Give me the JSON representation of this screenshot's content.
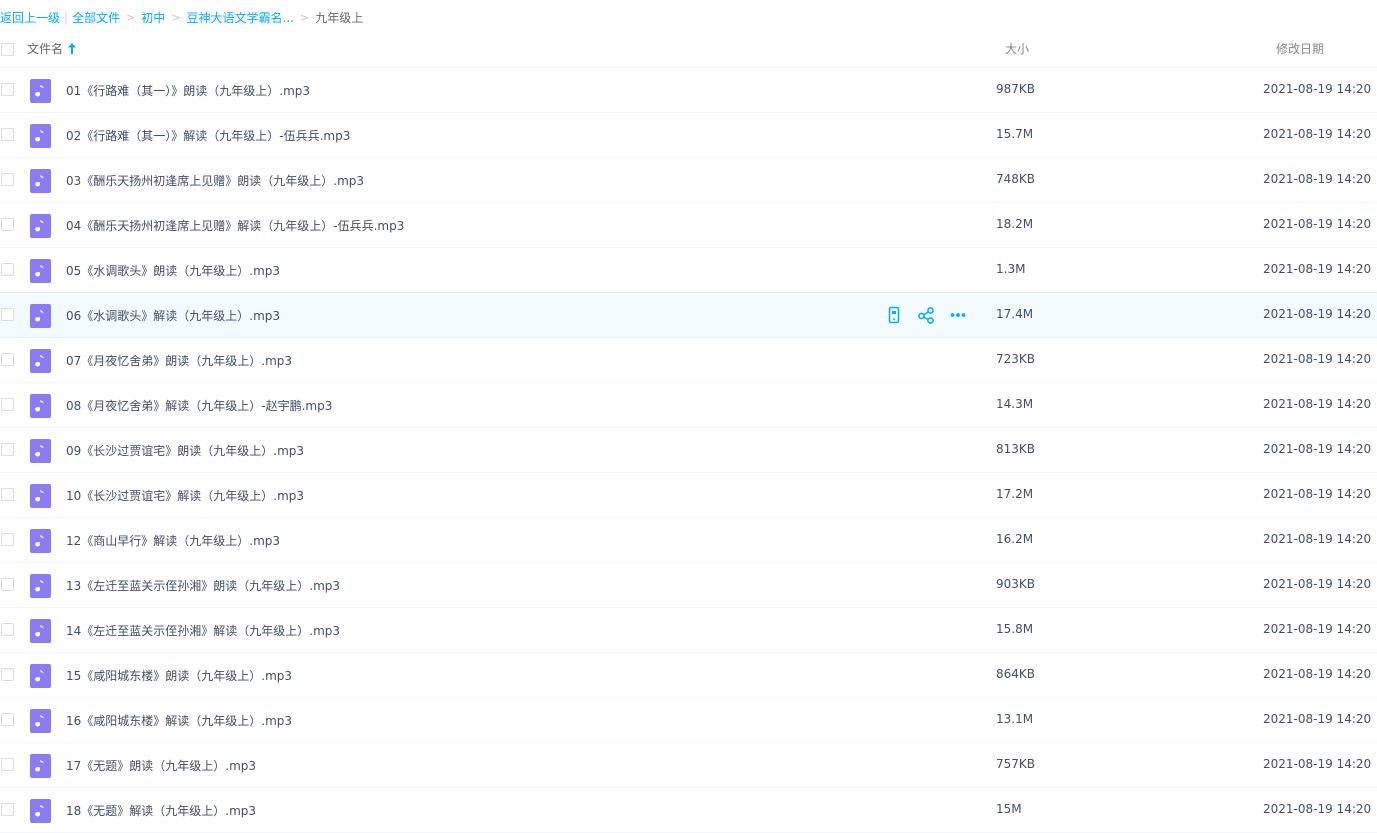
{
  "breadcrumb": {
    "back": "返回上一级",
    "separator": "|",
    "items": [
      {
        "label": "全部文件"
      },
      {
        "label": "初中"
      },
      {
        "label": "豆神大语文学霸名..."
      }
    ],
    "arrow": ">",
    "current": "九年级上"
  },
  "header": {
    "name": "文件名",
    "size": "大小",
    "date": "修改日期",
    "sort_icon": "arrow-up-icon"
  },
  "colors": {
    "accent": "#09aaff",
    "file_icon": "#8c7cf2",
    "hover_row": "#f4fbff"
  },
  "files": [
    {
      "name": "01《行路难（其一）》朗读（九年级上）.mp3",
      "size": "987KB",
      "date": "2021-08-19 14:20"
    },
    {
      "name": "02《行路难（其一）》解读（九年级上）-伍兵兵.mp3",
      "size": "15.7M",
      "date": "2021-08-19 14:20"
    },
    {
      "name": "03《酬乐天扬州初逢席上见赠》朗读（九年级上）.mp3",
      "size": "748KB",
      "date": "2021-08-19 14:20"
    },
    {
      "name": "04《酬乐天扬州初逢席上见赠》解读（九年级上）-伍兵兵.mp3",
      "size": "18.2M",
      "date": "2021-08-19 14:20"
    },
    {
      "name": "05《水调歌头》朗读（九年级上）.mp3",
      "size": "1.3M",
      "date": "2021-08-19 14:20"
    },
    {
      "name": "06《水调歌头》解读（九年级上）.mp3",
      "size": "17.4M",
      "date": "2021-08-19 14:20",
      "hover": true
    },
    {
      "name": "07《月夜忆舍弟》朗读（九年级上）.mp3",
      "size": "723KB",
      "date": "2021-08-19 14:20"
    },
    {
      "name": "08《月夜忆舍弟》解读（九年级上）-赵宇鹏.mp3",
      "size": "14.3M",
      "date": "2021-08-19 14:20"
    },
    {
      "name": "09《长沙过贾谊宅》朗读（九年级上）.mp3",
      "size": "813KB",
      "date": "2021-08-19 14:20"
    },
    {
      "name": "10《长沙过贾谊宅》解读（九年级上）.mp3",
      "size": "17.2M",
      "date": "2021-08-19 14:20"
    },
    {
      "name": "12《商山早行》解读（九年级上）.mp3",
      "size": "16.2M",
      "date": "2021-08-19 14:20"
    },
    {
      "name": "13《左迁至蓝关示侄孙湘》朗读（九年级上）.mp3",
      "size": "903KB",
      "date": "2021-08-19 14:20"
    },
    {
      "name": "14《左迁至蓝关示侄孙湘》解读（九年级上）.mp3",
      "size": "15.8M",
      "date": "2021-08-19 14:20"
    },
    {
      "name": "15《咸阳城东楼》朗读（九年级上）.mp3",
      "size": "864KB",
      "date": "2021-08-19 14:20"
    },
    {
      "name": "16《咸阳城东楼》解读（九年级上）.mp3",
      "size": "13.1M",
      "date": "2021-08-19 14:20"
    },
    {
      "name": "17《无题》朗读（九年级上）.mp3",
      "size": "757KB",
      "date": "2021-08-19 14:20"
    },
    {
      "name": "18《无题》解读（九年级上）.mp3",
      "size": "15M",
      "date": "2021-08-19 14:20"
    }
  ],
  "row_actions": [
    {
      "icon": "phone-icon"
    },
    {
      "icon": "share-icon"
    },
    {
      "icon": "more-icon"
    }
  ]
}
